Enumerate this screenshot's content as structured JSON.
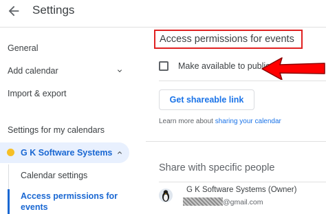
{
  "header": {
    "title": "Settings",
    "back_icon": "arrow-back-icon"
  },
  "sidebar": {
    "items": [
      {
        "label": "General"
      },
      {
        "label": "Add calendar"
      },
      {
        "label": "Import & export"
      }
    ],
    "section_label": "Settings for my calendars",
    "calendar": {
      "name": "G K Software Systems",
      "color": "#f6bf26"
    },
    "sub_items": [
      {
        "label": "Calendar settings"
      },
      {
        "label": "Access permissions for events"
      }
    ]
  },
  "main": {
    "section_title": "Access permissions for events",
    "public_option": {
      "label": "Make available to public",
      "checked": false
    },
    "share_button": "Get shareable link",
    "learn_more": {
      "prefix": "Learn more about ",
      "link": "sharing your calendar"
    },
    "share_section_title": "Share with specific people",
    "person": {
      "name": "G K Software Systems (Owner)",
      "email_suffix": "@gmail.com"
    }
  },
  "colors": {
    "accent": "#1a73e8",
    "active_text": "#1967d2",
    "highlight": "#e02020",
    "active_bg": "#e8f0fe"
  }
}
